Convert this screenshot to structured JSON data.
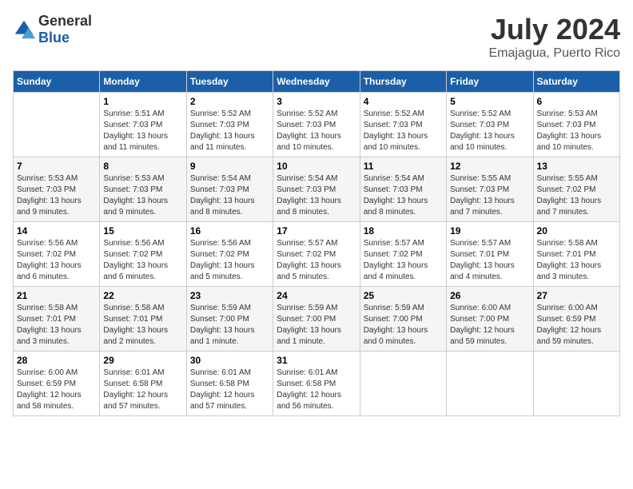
{
  "logo": {
    "general": "General",
    "blue": "Blue"
  },
  "title": "July 2024",
  "subtitle": "Emajagua, Puerto Rico",
  "days_header": [
    "Sunday",
    "Monday",
    "Tuesday",
    "Wednesday",
    "Thursday",
    "Friday",
    "Saturday"
  ],
  "weeks": [
    [
      {
        "num": "",
        "info": ""
      },
      {
        "num": "1",
        "info": "Sunrise: 5:51 AM\nSunset: 7:03 PM\nDaylight: 13 hours\nand 11 minutes."
      },
      {
        "num": "2",
        "info": "Sunrise: 5:52 AM\nSunset: 7:03 PM\nDaylight: 13 hours\nand 11 minutes."
      },
      {
        "num": "3",
        "info": "Sunrise: 5:52 AM\nSunset: 7:03 PM\nDaylight: 13 hours\nand 10 minutes."
      },
      {
        "num": "4",
        "info": "Sunrise: 5:52 AM\nSunset: 7:03 PM\nDaylight: 13 hours\nand 10 minutes."
      },
      {
        "num": "5",
        "info": "Sunrise: 5:52 AM\nSunset: 7:03 PM\nDaylight: 13 hours\nand 10 minutes."
      },
      {
        "num": "6",
        "info": "Sunrise: 5:53 AM\nSunset: 7:03 PM\nDaylight: 13 hours\nand 10 minutes."
      }
    ],
    [
      {
        "num": "7",
        "info": "Sunrise: 5:53 AM\nSunset: 7:03 PM\nDaylight: 13 hours\nand 9 minutes."
      },
      {
        "num": "8",
        "info": "Sunrise: 5:53 AM\nSunset: 7:03 PM\nDaylight: 13 hours\nand 9 minutes."
      },
      {
        "num": "9",
        "info": "Sunrise: 5:54 AM\nSunset: 7:03 PM\nDaylight: 13 hours\nand 8 minutes."
      },
      {
        "num": "10",
        "info": "Sunrise: 5:54 AM\nSunset: 7:03 PM\nDaylight: 13 hours\nand 8 minutes."
      },
      {
        "num": "11",
        "info": "Sunrise: 5:54 AM\nSunset: 7:03 PM\nDaylight: 13 hours\nand 8 minutes."
      },
      {
        "num": "12",
        "info": "Sunrise: 5:55 AM\nSunset: 7:03 PM\nDaylight: 13 hours\nand 7 minutes."
      },
      {
        "num": "13",
        "info": "Sunrise: 5:55 AM\nSunset: 7:02 PM\nDaylight: 13 hours\nand 7 minutes."
      }
    ],
    [
      {
        "num": "14",
        "info": "Sunrise: 5:56 AM\nSunset: 7:02 PM\nDaylight: 13 hours\nand 6 minutes."
      },
      {
        "num": "15",
        "info": "Sunrise: 5:56 AM\nSunset: 7:02 PM\nDaylight: 13 hours\nand 6 minutes."
      },
      {
        "num": "16",
        "info": "Sunrise: 5:56 AM\nSunset: 7:02 PM\nDaylight: 13 hours\nand 5 minutes."
      },
      {
        "num": "17",
        "info": "Sunrise: 5:57 AM\nSunset: 7:02 PM\nDaylight: 13 hours\nand 5 minutes."
      },
      {
        "num": "18",
        "info": "Sunrise: 5:57 AM\nSunset: 7:02 PM\nDaylight: 13 hours\nand 4 minutes."
      },
      {
        "num": "19",
        "info": "Sunrise: 5:57 AM\nSunset: 7:01 PM\nDaylight: 13 hours\nand 4 minutes."
      },
      {
        "num": "20",
        "info": "Sunrise: 5:58 AM\nSunset: 7:01 PM\nDaylight: 13 hours\nand 3 minutes."
      }
    ],
    [
      {
        "num": "21",
        "info": "Sunrise: 5:58 AM\nSunset: 7:01 PM\nDaylight: 13 hours\nand 3 minutes."
      },
      {
        "num": "22",
        "info": "Sunrise: 5:58 AM\nSunset: 7:01 PM\nDaylight: 13 hours\nand 2 minutes."
      },
      {
        "num": "23",
        "info": "Sunrise: 5:59 AM\nSunset: 7:00 PM\nDaylight: 13 hours\nand 1 minute."
      },
      {
        "num": "24",
        "info": "Sunrise: 5:59 AM\nSunset: 7:00 PM\nDaylight: 13 hours\nand 1 minute."
      },
      {
        "num": "25",
        "info": "Sunrise: 5:59 AM\nSunset: 7:00 PM\nDaylight: 13 hours\nand 0 minutes."
      },
      {
        "num": "26",
        "info": "Sunrise: 6:00 AM\nSunset: 7:00 PM\nDaylight: 12 hours\nand 59 minutes."
      },
      {
        "num": "27",
        "info": "Sunrise: 6:00 AM\nSunset: 6:59 PM\nDaylight: 12 hours\nand 59 minutes."
      }
    ],
    [
      {
        "num": "28",
        "info": "Sunrise: 6:00 AM\nSunset: 6:59 PM\nDaylight: 12 hours\nand 58 minutes."
      },
      {
        "num": "29",
        "info": "Sunrise: 6:01 AM\nSunset: 6:58 PM\nDaylight: 12 hours\nand 57 minutes."
      },
      {
        "num": "30",
        "info": "Sunrise: 6:01 AM\nSunset: 6:58 PM\nDaylight: 12 hours\nand 57 minutes."
      },
      {
        "num": "31",
        "info": "Sunrise: 6:01 AM\nSunset: 6:58 PM\nDaylight: 12 hours\nand 56 minutes."
      },
      {
        "num": "",
        "info": ""
      },
      {
        "num": "",
        "info": ""
      },
      {
        "num": "",
        "info": ""
      }
    ]
  ]
}
